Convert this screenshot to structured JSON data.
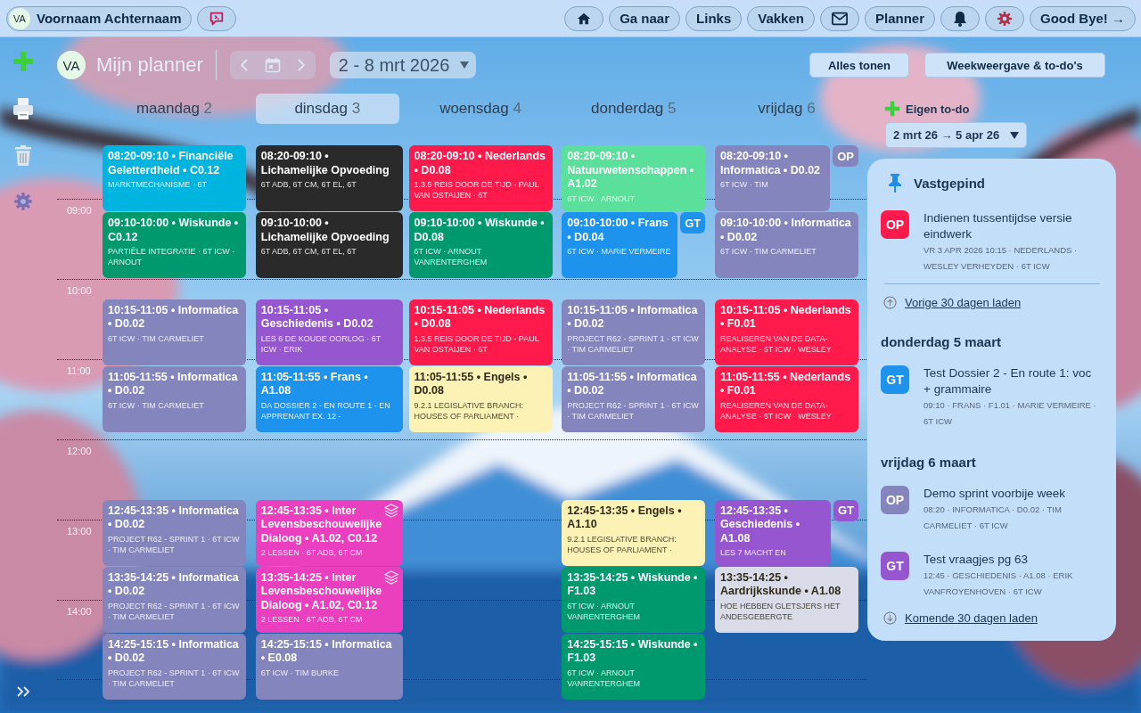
{
  "user": {
    "initials": "VA",
    "name": "Voornaam Achternaam"
  },
  "nav": [
    "Ga naar",
    "Links",
    "Vakken",
    "Planner"
  ],
  "logout": "Good Bye! →",
  "planner": {
    "initials": "VA",
    "title": "Mijn planner",
    "week": "2 - 8 mrt 2026",
    "buttons": [
      "Alles tonen",
      "Weekweergave & to-do's"
    ]
  },
  "hours": [
    "09:00",
    "10:00",
    "11:00",
    "12:00",
    "13:00",
    "14:00"
  ],
  "days": [
    {
      "name": "maandag",
      "date": "2",
      "selected": false,
      "lessons": [
        {
          "title": "08:20-09:10 • Financiële Geletterdheid • C0.12",
          "detail": "MARKTMECHANISME · 6T",
          "color": "#00b4e0",
          "stacked": false
        },
        {
          "title": "09:10-10:00 • Wiskunde • C0.12",
          "detail": "PARTIËLE INTEGRATIE · 6T ICW · ARNOUT",
          "color": "#00996e",
          "stacked": false
        },
        {
          "title": "10:15-11:05 • Informatica • D0.02",
          "detail": "6T ICW · TIM CARMELIET",
          "color": "#8385bc",
          "stacked": false
        },
        {
          "title": "11:05-11:55 • Informatica • D0.02",
          "detail": "6T ICW · TIM CARMELIET",
          "color": "#8385bc",
          "stacked": false
        },
        {
          "title": "12:45-13:35 • Informatica • D0.02",
          "detail": "PROJECT R62 - SPRINT 1 · 6T ICW · TIM CARMELIET",
          "color": "#8385bc",
          "stacked": false
        },
        {
          "title": "13:35-14:25 • Informatica • D0.02",
          "detail": "PROJECT R62 - SPRINT 1 · 6T ICW · TIM CARMELIET",
          "color": "#8385bc",
          "stacked": false
        },
        {
          "title": "14:25-15:15 • Informatica • D0.02",
          "detail": "PROJECT R62 - SPRINT 1 · 6T ICW · TIM CARMELIET",
          "color": "#8385bc",
          "stacked": false
        }
      ]
    },
    {
      "name": "dinsdag",
      "date": "3",
      "selected": true,
      "lessons": [
        {
          "title": "08:20-09:10 • Lichamelijke Opvoeding",
          "detail": "6T ADB, 6T CM, 6T EL, 6T",
          "color": "#2a2a2a",
          "stacked": false
        },
        {
          "title": "09:10-10:00 • Lichamelijke Opvoeding",
          "detail": "6T ADB, 6T CM, 6T EL, 6T",
          "color": "#2a2a2a",
          "stacked": false
        },
        {
          "title": "10:15-11:05 • Geschiedenis • D0.02",
          "detail": "LES 6 DE KOUDE OORLOG · 6T ICW · ERIK",
          "color": "#9656cf",
          "stacked": false
        },
        {
          "title": "11:05-11:55 • Frans • A1.08",
          "detail": "DA DOSSIER 2 - EN ROUTE 1 - EN APPRENANT EX. 12 -",
          "color": "#1e93ee",
          "stacked": false
        },
        {
          "title": "12:45-13:35 • Inter Levensbeschouwelijke Dialoog • A1.02, C0.12",
          "detail": "2 LESSEN · 6T ADB, 6T CM",
          "color": "#ea40bf",
          "stacked": true
        },
        {
          "title": "13:35-14:25 • Inter Levensbeschouwelijke Dialoog • A1.02, C0.12",
          "detail": "2 LESSEN · 6T ADB, 6T CM",
          "color": "#ea40bf",
          "stacked": true
        },
        {
          "title": "14:25-15:15 • Informatica • E0.08",
          "detail": "6T ICW · TIM BURKE",
          "color": "#8385bc",
          "stacked": false
        }
      ]
    },
    {
      "name": "woensdag",
      "date": "4",
      "selected": false,
      "lessons": [
        {
          "title": "08:20-09:10 • Nederlands • D0.08",
          "detail": "1.3.5 REIS DOOR DE TIJD - PAUL VAN OSTAIJEN · 6T",
          "color": "#ff1a4c",
          "stacked": false
        },
        {
          "title": "09:10-10:00 • Wiskunde • D0.08",
          "detail": "6T ICW · ARNOUT VANRENTERGHEM",
          "color": "#00996e",
          "stacked": false
        },
        {
          "title": "10:15-11:05 • Nederlands • D0.08",
          "detail": "1.3.5 REIS DOOR DE TIJD - PAUL VAN OSTAIJEN · 6T",
          "color": "#ff1a4c",
          "stacked": false
        },
        {
          "title": "11:05-11:55 • Engels • D0.08",
          "detail": "9.2.1 LEGISLATIVE BRANCH: HOUSES OF PARLIAMENT ·",
          "color": "#fdf2b5",
          "stacked": false
        }
      ]
    },
    {
      "name": "donderdag",
      "date": "5",
      "selected": false,
      "lessons": [
        {
          "title": "08:20-09:10 • Natuurwetenschappen • A1.02",
          "detail": "6T ICW · ARNOUT",
          "color": "#5ae09b",
          "stacked": false
        },
        {
          "title": "09:10-10:00 • Frans • D0.04",
          "detail": "6T ICW · MARIE VERMEIRE",
          "color": "#1e93ee",
          "stacked": false,
          "badge": "GT"
        },
        {
          "title": "10:15-11:05 • Informatica • D0.02",
          "detail": "PROJECT R62 - SPRINT 1 · 6T ICW · TIM CARMELIET",
          "color": "#8385bc",
          "stacked": false
        },
        {
          "title": "11:05-11:55 • Informatica • D0.02",
          "detail": "PROJECT R62 - SPRINT 1 · 6T ICW · TIM CARMELIET",
          "color": "#8385bc",
          "stacked": false
        },
        {
          "title": "12:45-13:35 • Engels • A1.10",
          "detail": "9.2.1 LEGISLATIVE BRANCH: HOUSES OF PARLIAMENT ·",
          "color": "#fdf2b5",
          "stacked": false
        },
        {
          "title": "13:35-14:25 • Wiskunde • F1.03",
          "detail": "6T ICW · ARNOUT VANRENTERGHEM",
          "color": "#00996e",
          "stacked": false
        },
        {
          "title": "14:25-15:15 • Wiskunde • F1.03",
          "detail": "6T ICW · ARNOUT VANRENTERGHEM",
          "color": "#00996e",
          "stacked": false
        }
      ]
    },
    {
      "name": "vrijdag",
      "date": "6",
      "selected": false,
      "lessons": [
        {
          "title": "08:20-09:10 • Informatica • D0.02",
          "detail": "6T ICW · TIM",
          "color": "#8385bc",
          "stacked": false,
          "badge": "OP"
        },
        {
          "title": "09:10-10:00 • Informatica • D0.02",
          "detail": "6T ICW · TIM CARMELIET",
          "color": "#8385bc",
          "stacked": false
        },
        {
          "title": "10:15-11:05 • Nederlands • F0.01",
          "detail": "REALISEREN VAN DE DATA-ANALYSE · 6T ICW · WESLEY",
          "color": "#ff1a4c",
          "stacked": false
        },
        {
          "title": "11:05-11:55 • Nederlands • F0.01",
          "detail": "REALISEREN VAN DE DATA-ANALYSE · 6T ICW · WESLEY",
          "color": "#ff1a4c",
          "stacked": false
        },
        {
          "title": "12:45-13:35 • Geschiedenis • A1.08",
          "detail": "LES 7 MACHT EN",
          "color": "#9656cf",
          "stacked": false,
          "badge": "GT"
        },
        {
          "title": "13:35-14:25 • Aardrijkskunde • A1.08",
          "detail": "HOE HEBBEN GLETSJERS HET ANDESGEBERGTE",
          "color": "#d9dbe9",
          "stacked": false
        }
      ]
    }
  ],
  "todo": {
    "title": "Eigen to-do",
    "range": "2 mrt 26 → 5 apr 26",
    "pinned": {
      "title": "Vastgepind",
      "items": [
        {
          "tag": "OP",
          "color": "#ff1a4c",
          "title": "Indienen tussentijdse versie eindwerk",
          "meta": "VR 3 APR 2026 10:15 · NEDERLANDS · WESLEY VERHEYDEN · 6T ICW"
        }
      ]
    },
    "load_previous": "Vorige 30 dagen laden",
    "groups": [
      {
        "heading": "donderdag 5 maart",
        "items": [
          {
            "tag": "GT",
            "color": "#1e93ee",
            "title": "Test Dossier 2 - En route 1: voc + grammaire",
            "meta": "09:10 · FRANS · F1.01 · MARIE VERMEIRE · 6T ICW"
          }
        ]
      },
      {
        "heading": "vrijdag 6 maart",
        "items": [
          {
            "tag": "OP",
            "color": "#8385bc",
            "title": "Demo sprint voorbije week",
            "meta": "08:20 · INFORMATICA · D0.02 · TIM CARMELIET · 6T ICW"
          },
          {
            "tag": "GT",
            "color": "#9656cf",
            "title": "Test vraagjes pg 63",
            "meta": "12:45 · GESCHIEDENIS · A1.08 · ERIK VANFROYENHOVEN · 6T ICW"
          }
        ]
      }
    ],
    "load_next": "Komende 30 dagen laden"
  }
}
